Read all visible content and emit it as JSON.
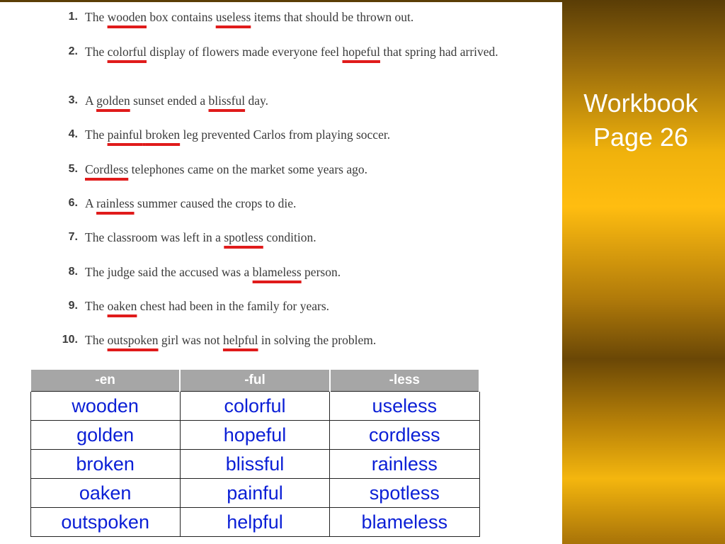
{
  "sentences": [
    {
      "num": "1.",
      "parts": [
        "The ",
        "wooden",
        " box contains ",
        "useless",
        " items that should be thrown out."
      ]
    },
    {
      "num": "2.",
      "parts": [
        "The ",
        "colorful",
        " display of flowers made everyone feel ",
        "hopeful",
        " that spring had arrived."
      ]
    },
    {
      "num": "3.",
      "parts": [
        "A ",
        "golden",
        " sunset ended a ",
        "blissful",
        " day."
      ]
    },
    {
      "num": "4.",
      "parts": [
        "The ",
        "painful",
        " ",
        "broken",
        " leg prevented Carlos from playing soccer."
      ]
    },
    {
      "num": "5.",
      "parts": [
        "",
        "Cordless",
        " telephones came on the market some years ago."
      ]
    },
    {
      "num": "6.",
      "parts": [
        "A ",
        "rainless",
        " summer caused the crops to die."
      ]
    },
    {
      "num": "7.",
      "parts": [
        "The classroom was left in a ",
        "spotless",
        " condition."
      ]
    },
    {
      "num": "8.",
      "parts": [
        "The judge said the accused was a ",
        "blameless",
        " person."
      ]
    },
    {
      "num": "9.",
      "parts": [
        "The ",
        "oaken",
        " chest had been in the family for years."
      ]
    },
    {
      "num": "10.",
      "parts": [
        "The ",
        "outspoken",
        " girl was not ",
        "helpful",
        " in solving the problem."
      ]
    }
  ],
  "title": {
    "line1": "Workbook",
    "line2": "Page 26"
  },
  "table": {
    "headers": [
      "-en",
      "-ful",
      "-less"
    ],
    "rows": [
      [
        "wooden",
        "colorful",
        "useless"
      ],
      [
        "golden",
        "hopeful",
        "cordless"
      ],
      [
        "broken",
        "blissful",
        "rainless"
      ],
      [
        "oaken",
        "painful",
        "spotless"
      ],
      [
        "outspoken",
        "helpful",
        "blameless"
      ]
    ]
  },
  "colors": {
    "underline": "#e01b1b",
    "answer_text": "#0b1fd6",
    "header_bg": "#a6a6a6"
  }
}
